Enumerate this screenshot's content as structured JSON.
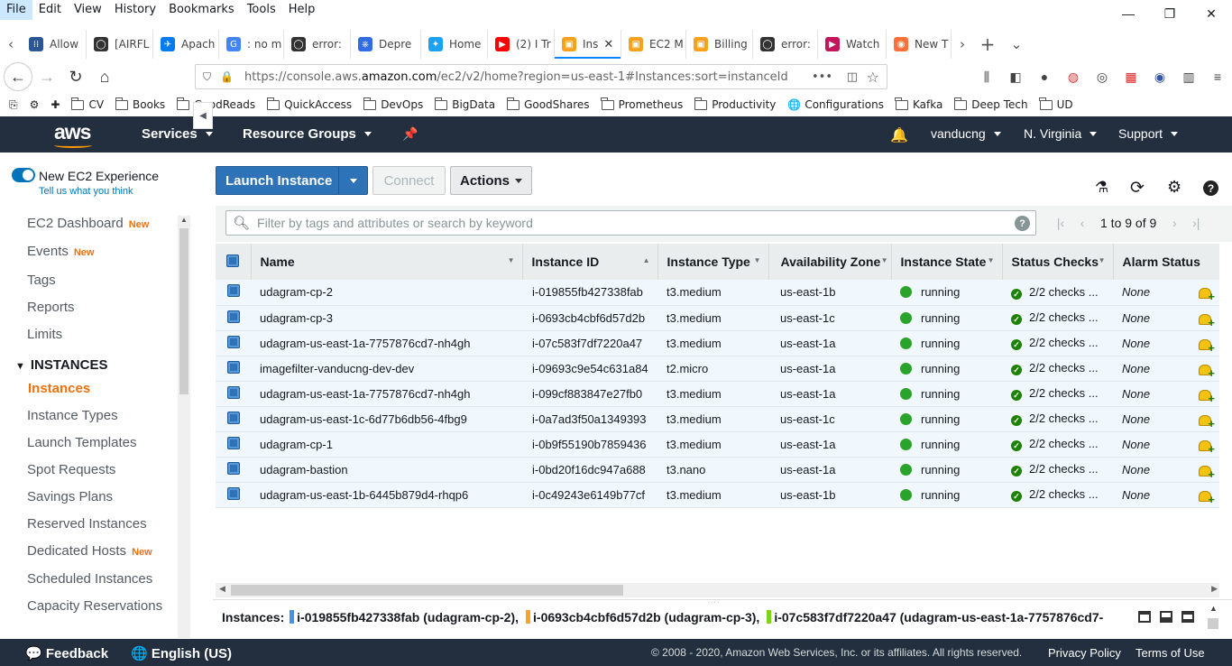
{
  "menubar": [
    "File",
    "Edit",
    "View",
    "History",
    "Bookmarks",
    "Tools",
    "Help"
  ],
  "tabs": [
    {
      "label": "Allow",
      "color": "#2b5797",
      "glyph": "⁞⁞"
    },
    {
      "label": "[AIRFL",
      "color": "#333333",
      "glyph": "◯"
    },
    {
      "label": "Apach",
      "color": "#017cee",
      "glyph": "✈"
    },
    {
      "label": ": no m",
      "color": "#4285f4",
      "glyph": "G"
    },
    {
      "label": "error:",
      "color": "#333333",
      "glyph": "◯"
    },
    {
      "label": "Depre",
      "color": "#326ce5",
      "glyph": "⎈"
    },
    {
      "label": "Home",
      "color": "#1da1f2",
      "glyph": "✦"
    },
    {
      "label": "(2) I Tr",
      "color": "#ff0000",
      "glyph": "▶"
    },
    {
      "label": "Ins",
      "color": "#f7a21b",
      "glyph": "▣",
      "selected": true
    },
    {
      "label": "EC2 M",
      "color": "#f7a21b",
      "glyph": "▣"
    },
    {
      "label": "Billing",
      "color": "#f7a21b",
      "glyph": "▣"
    },
    {
      "label": "error:",
      "color": "#333333",
      "glyph": "◯"
    },
    {
      "label": "Watch",
      "color": "#c2185b",
      "glyph": "▶"
    },
    {
      "label": "New T",
      "color": "#ff7139",
      "glyph": "◉"
    }
  ],
  "url": {
    "prefix": "https://console.aws.",
    "domain": "amazon.com",
    "suffix": "/ec2/v2/home?region=us-east-1#Instances:sort=instanceId"
  },
  "bookmarks": [
    "CV",
    "Books",
    "GoodReads",
    "QuickAccess",
    "DevOps",
    "BigData",
    "GoodShares",
    "Prometheus",
    "Productivity",
    "Configurations",
    "Kafka",
    "Deep Tech",
    "UD"
  ],
  "aws": {
    "logo": "aws",
    "services": "Services",
    "resource_groups": "Resource Groups",
    "user": "vanducng",
    "region": "N. Virginia",
    "support": "Support"
  },
  "sidebar": {
    "new_experience": "New EC2 Experience",
    "tell_us": "Tell us what you think",
    "items": [
      {
        "label": "EC2 Dashboard",
        "badge": "New"
      },
      {
        "label": "Events",
        "badge": "New"
      },
      {
        "label": "Tags",
        "badge": ""
      },
      {
        "label": "Reports",
        "badge": ""
      },
      {
        "label": "Limits",
        "badge": ""
      }
    ],
    "section": "INSTANCES",
    "section_items": [
      {
        "label": "Instances",
        "badge": "",
        "current": true
      },
      {
        "label": "Instance Types",
        "badge": ""
      },
      {
        "label": "Launch Templates",
        "badge": ""
      },
      {
        "label": "Spot Requests",
        "badge": ""
      },
      {
        "label": "Savings Plans",
        "badge": ""
      },
      {
        "label": "Reserved Instances",
        "badge": ""
      },
      {
        "label": "Dedicated Hosts",
        "badge": "New"
      },
      {
        "label": "Scheduled Instances",
        "badge": ""
      },
      {
        "label": "Capacity Reservations",
        "badge": ""
      }
    ]
  },
  "toolbar": {
    "launch": "Launch Instance",
    "connect": "Connect",
    "actions": "Actions"
  },
  "filter": {
    "placeholder": "Filter by tags and attributes or search by keyword",
    "pager": "1 to 9 of 9"
  },
  "columns": [
    "Name",
    "Instance ID",
    "Instance Type",
    "Availability Zone",
    "Instance State",
    "Status Checks",
    "Alarm Status"
  ],
  "rows": [
    {
      "name": "udagram-cp-2",
      "id": "i-019855fb427338fab",
      "type": "t3.medium",
      "az": "us-east-1b",
      "state": "running",
      "checks": "2/2 checks ...",
      "alarm": "None"
    },
    {
      "name": "udagram-cp-3",
      "id": "i-0693cb4cbf6d57d2b",
      "type": "t3.medium",
      "az": "us-east-1c",
      "state": "running",
      "checks": "2/2 checks ...",
      "alarm": "None"
    },
    {
      "name": "udagram-us-east-1a-7757876cd7-nh4gh",
      "id": "i-07c583f7df7220a47",
      "type": "t3.medium",
      "az": "us-east-1a",
      "state": "running",
      "checks": "2/2 checks ...",
      "alarm": "None"
    },
    {
      "name": "imagefilter-vanducng-dev-dev",
      "id": "i-09693c9e54c631a84",
      "type": "t2.micro",
      "az": "us-east-1a",
      "state": "running",
      "checks": "2/2 checks ...",
      "alarm": "None"
    },
    {
      "name": "udagram-us-east-1a-7757876cd7-nh4gh",
      "id": "i-099cf883847e27fb0",
      "type": "t3.medium",
      "az": "us-east-1a",
      "state": "running",
      "checks": "2/2 checks ...",
      "alarm": "None"
    },
    {
      "name": "udagram-us-east-1c-6d77b6db56-4fbg9",
      "id": "i-0a7ad3f50a1349393",
      "type": "t3.medium",
      "az": "us-east-1c",
      "state": "running",
      "checks": "2/2 checks ...",
      "alarm": "None"
    },
    {
      "name": "udagram-cp-1",
      "id": "i-0b9f55190b7859436",
      "type": "t3.medium",
      "az": "us-east-1a",
      "state": "running",
      "checks": "2/2 checks ...",
      "alarm": "None"
    },
    {
      "name": "udagram-bastion",
      "id": "i-0bd20f16dc947a688",
      "type": "t3.nano",
      "az": "us-east-1a",
      "state": "running",
      "checks": "2/2 checks ...",
      "alarm": "None"
    },
    {
      "name": "udagram-us-east-1b-6445b879d4-rhqp6",
      "id": "i-0c49243e6149b77cf",
      "type": "t3.medium",
      "az": "us-east-1b",
      "state": "running",
      "checks": "2/2 checks ...",
      "alarm": "None"
    }
  ],
  "selection": {
    "label": "Instances:",
    "items": [
      {
        "text": "i-019855fb427338fab (udagram-cp-2),",
        "color": "#4a90e2"
      },
      {
        "text": "i-0693cb4cbf6d57d2b (udagram-cp-3),",
        "color": "#f5a623"
      },
      {
        "text": "i-07c583f7df7220a47 (udagram-us-east-1a-7757876cd7-",
        "color": "#7ed321"
      }
    ]
  },
  "footer": {
    "feedback": "Feedback",
    "language": "English (US)",
    "copyright": "© 2008 - 2020, Amazon Web Services, Inc. or its affiliates. All rights reserved.",
    "privacy": "Privacy Policy",
    "terms": "Terms of Use"
  }
}
